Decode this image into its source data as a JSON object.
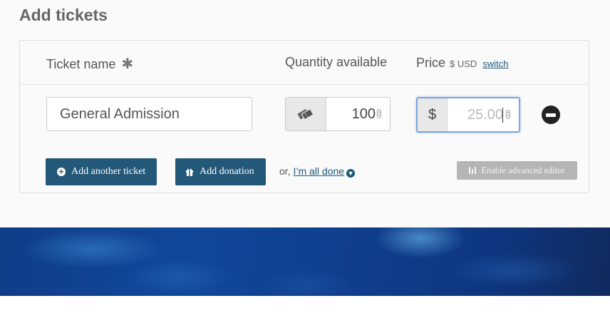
{
  "page": {
    "title": "Add tickets"
  },
  "table_header": {
    "ticket_name_label": "Ticket name",
    "required_icon": "asterisk-icon",
    "quantity_label": "Quantity available",
    "price_label": "Price",
    "price_currency": "$ USD",
    "switch_label": "switch"
  },
  "ticket": {
    "name_value": "General Admission",
    "quantity_icon": "tickets-icon",
    "quantity_value": "100",
    "currency_symbol": "$",
    "price_value": "25.00",
    "remove_icon": "minus-circle-icon"
  },
  "actions": {
    "add_ticket_label": "Add another ticket",
    "add_ticket_icon": "plus-circle-icon",
    "add_donation_label": "Add donation",
    "add_donation_icon": "gift-icon",
    "or_text": "or,",
    "done_label": "I’m all done",
    "done_icon": "arrow-down-circle-icon",
    "advanced_editor_label": "Enable advanced editor",
    "advanced_editor_icon": "sliders-icon"
  },
  "colors": {
    "primary_button": "#245878",
    "link": "#1a5a7a",
    "disabled_button": "#b5b5b5",
    "focus_border": "#7aa7e0",
    "banner": "#11479a"
  }
}
